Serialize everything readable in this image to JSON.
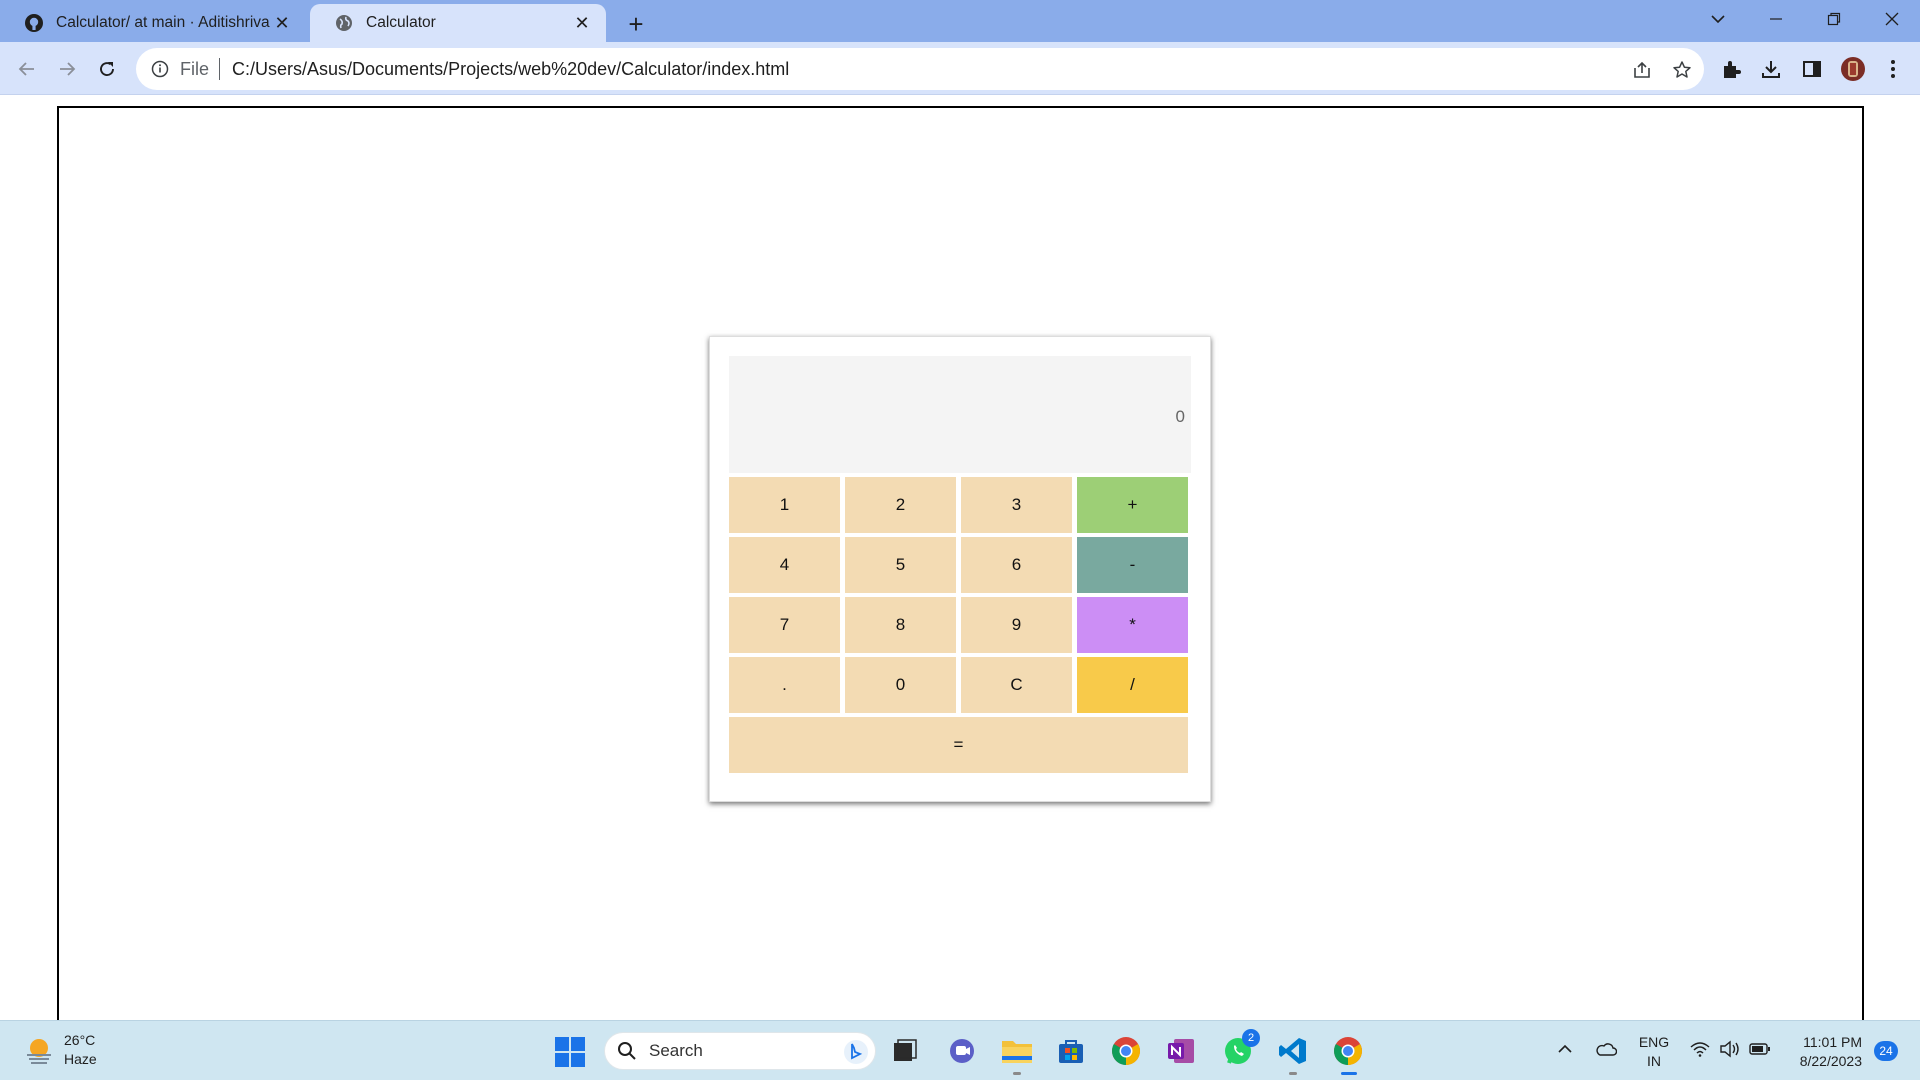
{
  "browser": {
    "tabs": [
      {
        "title": "Calculator/ at main · Aditishrivas/",
        "favicon": "github-icon",
        "active": false
      },
      {
        "title": "Calculator",
        "favicon": "globe-icon",
        "active": true
      }
    ],
    "address_bar": {
      "scheme": "File",
      "url": "C:/Users/Asus/Documents/Projects/web%20dev/Calculator/index.html"
    }
  },
  "calculator": {
    "display": "0",
    "keys": [
      {
        "label": "1",
        "kind": "digit",
        "color": "#f3dbb3"
      },
      {
        "label": "2",
        "kind": "digit",
        "color": "#f3dbb3"
      },
      {
        "label": "3",
        "kind": "digit",
        "color": "#f3dbb3"
      },
      {
        "label": "+",
        "kind": "operator",
        "color": "#9dcf76"
      },
      {
        "label": "4",
        "kind": "digit",
        "color": "#f3dbb3"
      },
      {
        "label": "5",
        "kind": "digit",
        "color": "#f3dbb3"
      },
      {
        "label": "6",
        "kind": "digit",
        "color": "#f3dbb3"
      },
      {
        "label": "-",
        "kind": "operator",
        "color": "#79a99f"
      },
      {
        "label": "7",
        "kind": "digit",
        "color": "#f3dbb3"
      },
      {
        "label": "8",
        "kind": "digit",
        "color": "#f3dbb3"
      },
      {
        "label": "9",
        "kind": "digit",
        "color": "#f3dbb3"
      },
      {
        "label": "*",
        "kind": "operator",
        "color": "#cc8ef5"
      },
      {
        "label": ".",
        "kind": "decimal",
        "color": "#f3dbb3"
      },
      {
        "label": "0",
        "kind": "digit",
        "color": "#f3dbb3"
      },
      {
        "label": "C",
        "kind": "clear",
        "color": "#f3dbb3"
      },
      {
        "label": "/",
        "kind": "operator",
        "color": "#f8ca4a"
      },
      {
        "label": "=",
        "kind": "equals",
        "color": "#f3dbb3"
      }
    ]
  },
  "taskbar": {
    "weather": {
      "temp": "26°C",
      "condition": "Haze"
    },
    "search_placeholder": "Search",
    "whatsapp_badge": "2",
    "language": {
      "line1": "ENG",
      "line2": "IN"
    },
    "clock": {
      "time": "11:01 PM",
      "date": "8/22/2023"
    },
    "notifications": "24"
  }
}
